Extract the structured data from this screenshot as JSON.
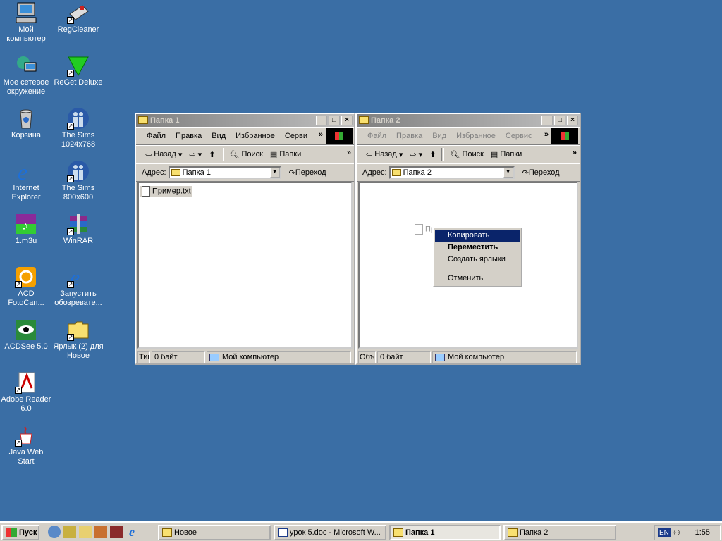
{
  "desktop": {
    "icons": [
      {
        "label": "Мой компьютер"
      },
      {
        "label": "RegCleaner"
      },
      {
        "label": "Мое сетевое окружение"
      },
      {
        "label": "ReGet Deluxe"
      },
      {
        "label": "Корзина"
      },
      {
        "label": "The Sims 1024x768"
      },
      {
        "label": "Internet Explorer"
      },
      {
        "label": "The Sims 800x600"
      },
      {
        "label": "1.m3u"
      },
      {
        "label": "WinRAR"
      },
      {
        "label": "ACD FotoCan..."
      },
      {
        "label": "Запустить обозревате..."
      },
      {
        "label": "ACDSee 5.0"
      },
      {
        "label": "Ярлык (2) для Новое"
      },
      {
        "label": "Adobe Reader 6.0"
      },
      {
        "label": "Java Web Start"
      }
    ]
  },
  "window1": {
    "title": "Папка 1",
    "menu": [
      "Файл",
      "Правка",
      "Вид",
      "Избранное",
      "Серви"
    ],
    "toolbar": {
      "back": "Назад",
      "search": "Поиск",
      "folders": "Папки"
    },
    "address_label": "Адрес:",
    "address_value": "Папка 1",
    "go_label": "Переход",
    "file": "Пример.txt",
    "status": {
      "type": "Тиг",
      "size": "0 байт",
      "zone": "Мой компьютер"
    }
  },
  "window2": {
    "title": "Папка 2",
    "menu": [
      "Файл",
      "Правка",
      "Вид",
      "Избранное",
      "Сервис"
    ],
    "toolbar": {
      "back": "Назад",
      "search": "Поиск",
      "folders": "Папки"
    },
    "address_label": "Адрес:",
    "address_value": "Папка 2",
    "go_label": "Переход",
    "file_partial": "Пр",
    "status": {
      "type": "Объ",
      "size": "0 байт",
      "zone": "Мой компьютер"
    }
  },
  "context_menu": {
    "copy": "Копировать",
    "move": "Переместить",
    "shortcut": "Создать ярлыки",
    "cancel": "Отменить"
  },
  "taskbar": {
    "start": "Пуск",
    "tasks": [
      "Новое",
      "урок 5.doc - Microsoft W...",
      "Папка 1",
      "Папка 2"
    ],
    "lang": "EN",
    "clock": "1:55"
  }
}
